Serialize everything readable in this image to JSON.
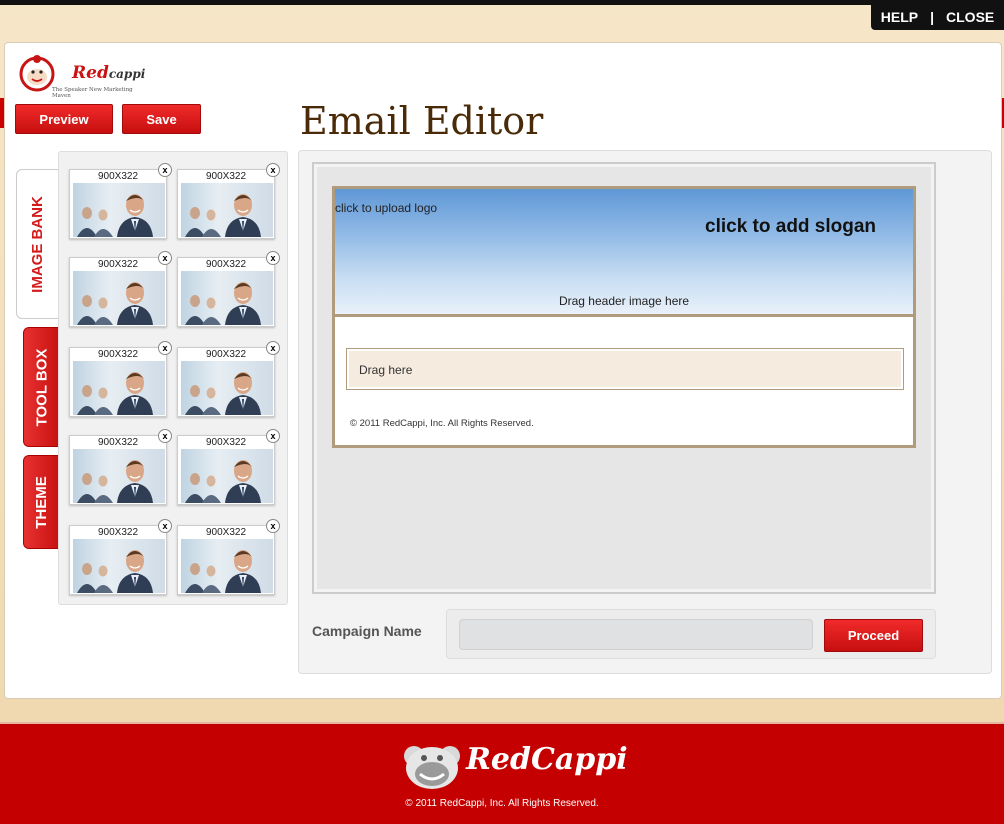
{
  "topbar": {
    "help": "HELP",
    "separator": "|",
    "close": "CLOSE"
  },
  "brand": {
    "name_red": "Red",
    "name_rest": "cappi",
    "tagline": "The Speaker New Marketing Maven"
  },
  "toolbar": {
    "preview": "Preview",
    "save": "Save"
  },
  "page_title": "Email Editor",
  "tabs": [
    {
      "label": "IMAGE BANK"
    },
    {
      "label": "TOOL BOX"
    },
    {
      "label": "THEME"
    }
  ],
  "image_bank": {
    "items": [
      {
        "size": "900X322",
        "remove": "x"
      },
      {
        "size": "900X322",
        "remove": "x"
      },
      {
        "size": "900X322",
        "remove": "x"
      },
      {
        "size": "900X322",
        "remove": "x"
      },
      {
        "size": "900X322",
        "remove": "x"
      },
      {
        "size": "900X322",
        "remove": "x"
      },
      {
        "size": "900X322",
        "remove": "x"
      },
      {
        "size": "900X322",
        "remove": "x"
      },
      {
        "size": "900X322",
        "remove": "x"
      },
      {
        "size": "900X322",
        "remove": "x"
      }
    ]
  },
  "email": {
    "upload_logo": "click to upload logo",
    "slogan": "click to add slogan",
    "drag_header": "Drag header image here",
    "drag_here": "Drag here",
    "copyright": "© 2011 RedCappi, Inc. All Rights Reserved."
  },
  "campaign": {
    "label": "Campaign Name",
    "value": "",
    "placeholder": "",
    "proceed": "Proceed"
  },
  "footer": {
    "brand": "RedCappi",
    "copyright": "© 2011 RedCappi, Inc. All Rights Reserved."
  },
  "colors": {
    "accent": "#c40000",
    "title": "#4a2a07",
    "header_sky": "#8fb9e6"
  }
}
